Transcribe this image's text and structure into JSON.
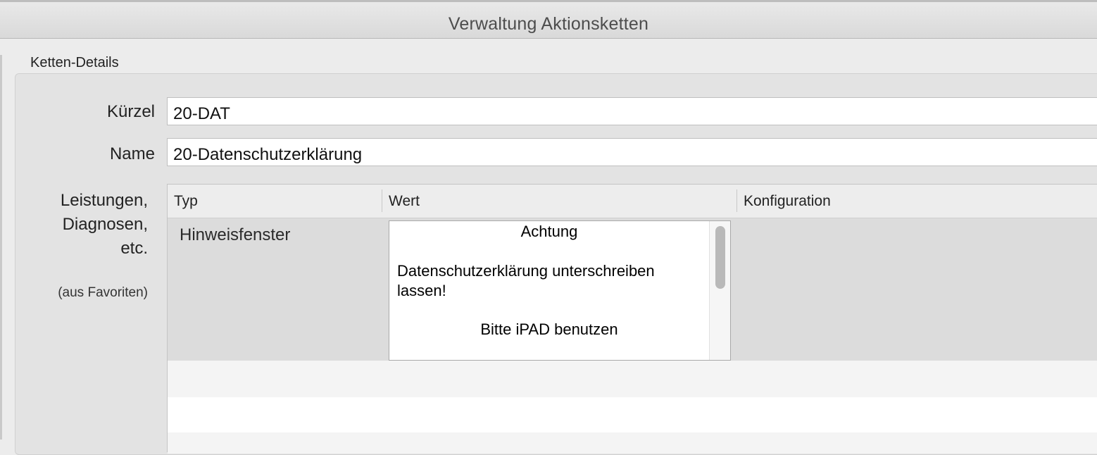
{
  "window": {
    "title": "Verwaltung Aktionsketten"
  },
  "section": {
    "label": "Ketten-Details"
  },
  "fields": {
    "kuerzel": {
      "label": "Kürzel",
      "value": "20-DAT"
    },
    "name": {
      "label": "Name",
      "value": "20-Datenschutzerklärung"
    }
  },
  "leistungen": {
    "label_line1": "Leistungen,",
    "label_line2": "Diagnosen,",
    "label_line3": "etc.",
    "sublabel": "(aus Favoriten)"
  },
  "table": {
    "columns": [
      "Typ",
      "Wert",
      "Konfiguration"
    ],
    "rows": [
      {
        "typ": "Hinweisfenster",
        "wert": {
          "title": "Achtung",
          "body": "Datenschutzerklärung unterschreiben lassen!",
          "footer": "Bitte iPAD benutzen"
        },
        "konfiguration": ""
      }
    ]
  }
}
